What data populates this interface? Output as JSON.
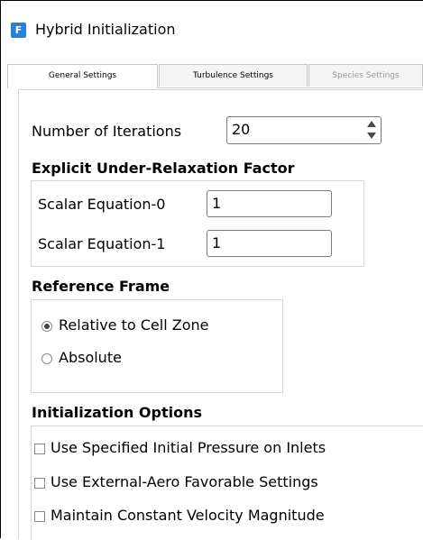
{
  "window": {
    "title": "Hybrid Initialization",
    "icon_letter": "F",
    "icon": "fluent-app-icon"
  },
  "tabs": [
    {
      "label": "General Settings",
      "state": "active"
    },
    {
      "label": "Turbulence Settings",
      "state": "normal"
    },
    {
      "label": "Species Settings",
      "state": "disabled"
    }
  ],
  "iterations": {
    "label": "Number of Iterations",
    "value": "20"
  },
  "relaxation": {
    "heading": "Explicit Under-Relaxation Factor",
    "scalar0": {
      "label": "Scalar Equation-0",
      "value": "1"
    },
    "scalar1": {
      "label": "Scalar Equation-1",
      "value": "1"
    }
  },
  "reference_frame": {
    "heading": "Reference Frame",
    "options": [
      {
        "label": "Relative to Cell Zone",
        "selected": true
      },
      {
        "label": "Absolute",
        "selected": false
      }
    ]
  },
  "init_options": {
    "heading": "Initialization Options",
    "items": [
      {
        "label": "Use Specified Initial Pressure on Inlets",
        "checked": false
      },
      {
        "label": "Use External-Aero Favorable Settings",
        "checked": false
      },
      {
        "label": "Maintain Constant Velocity Magnitude",
        "checked": false
      }
    ]
  },
  "colors": {
    "accent": "#2b7fd6",
    "border": "#d6d6d6"
  }
}
